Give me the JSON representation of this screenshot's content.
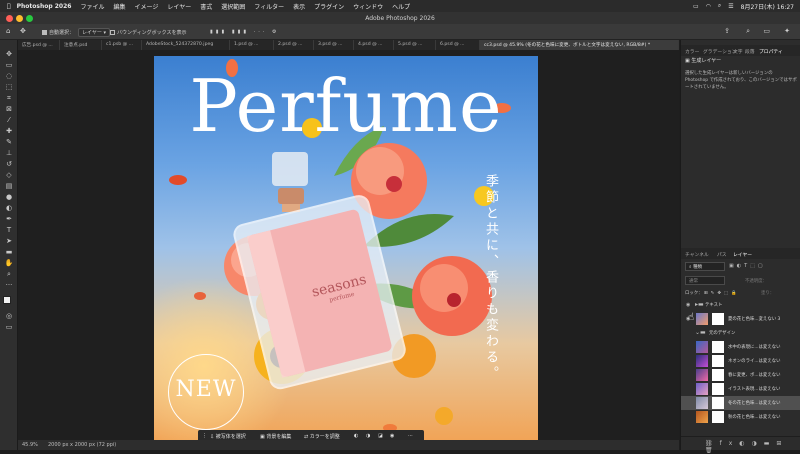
{
  "menubar": {
    "app": "Photoshop 2026",
    "items": [
      "ファイル",
      "編集",
      "イメージ",
      "レイヤー",
      "書式",
      "選択範囲",
      "フィルター",
      "表示",
      "プラグイン",
      "ウィンドウ",
      "ヘルプ"
    ],
    "datetime": "8月27日(木) 16:27"
  },
  "window": {
    "title": "Adobe Photoshop 2026"
  },
  "options": {
    "auto_select": "自動選択：",
    "layer_dropdown": "レイヤー",
    "bounding_box": "バウンディングボックスを表示"
  },
  "doc_tabs": [
    "広告.psd @ ...",
    "注意点.psd",
    "c1.psb @ ...",
    "AdobeStock_524372870.jpeg",
    "1.psd @ ...",
    "2.psd @ ...",
    "3.psd @ ...",
    "4.psd @ ...",
    "5.psd @ ...",
    "6.psd @ ...",
    "cc3.psd @ 45.9% (冬の花と色味に変更、ボトルと文字は変えない, RGB/8#) *"
  ],
  "artwork": {
    "headline": "Perfume",
    "vertical_copy": "季節と共に、香りも変わる。",
    "bottle_brand": "seasons",
    "bottle_sub": "perfume",
    "badge": "NEW"
  },
  "context_bar": {
    "select_subject": "被写体を選択",
    "edit_background": "背景を編集",
    "adjust_color": "カラーを調整"
  },
  "status": {
    "zoom": "45.9%",
    "doc_size": "2000 px x 2000 px (72 ppi)"
  },
  "properties_panel": {
    "tabs": [
      "カラー",
      "グラデーション",
      "文字",
      "段落",
      "プロパティ"
    ],
    "header": "生成レイヤー",
    "message": "選択した生成レイヤーは新しいバージョンの Photoshop で作成されており、このバージョンではサポートされていません。"
  },
  "layers_panel": {
    "tabs": [
      "チャンネル",
      "パス",
      "レイヤー"
    ],
    "filter": "種類",
    "blend_mode": "通常",
    "opacity_label": "不透明度：",
    "lock_label": "ロック：",
    "fill_label": "塗り：",
    "layers": [
      {
        "type": "folder",
        "name": "テキスト"
      },
      {
        "type": "layer",
        "name": "夏の花と色味...変えない 3"
      },
      {
        "type": "folder",
        "name": "元のデザイン"
      },
      {
        "type": "layer",
        "name": "水中の表現に...は変えない"
      },
      {
        "type": "layer",
        "name": "ネオンのライ...は変えない"
      },
      {
        "type": "layer",
        "name": "春に変更、ボ...は変えない"
      },
      {
        "type": "layer",
        "name": "イラスト表現...は変えない"
      },
      {
        "type": "layer",
        "name": "冬の花と色味...は変えない"
      },
      {
        "type": "layer",
        "name": "秋の花と色味...は変えない"
      }
    ],
    "selected_index": 7
  }
}
